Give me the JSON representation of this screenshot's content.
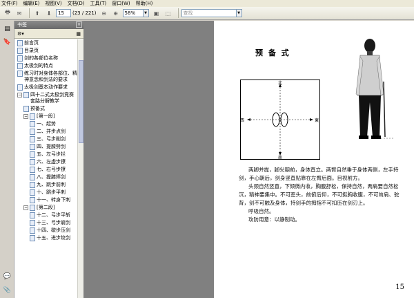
{
  "menu": [
    "文件(F)",
    "编辑(E)",
    "视图(V)",
    "文档(D)",
    "工具(T)",
    "窗口(W)",
    "帮助(H)"
  ],
  "toolbar": {
    "page_current": "15",
    "page_total": "(23 / 221)",
    "zoom": "58%",
    "find_placeholder": "查找"
  },
  "panel": {
    "title": "书签",
    "close": "×"
  },
  "bookmarks": [
    {
      "label": "前言页",
      "level": 0,
      "expander": ""
    },
    {
      "label": "目录页",
      "level": 0,
      "expander": ""
    },
    {
      "label": "剑的各部位名称",
      "level": 0,
      "expander": ""
    },
    {
      "label": "太极剑的特点",
      "level": 0,
      "expander": ""
    },
    {
      "label": "练习时对身体各部位、精神意念和剑法的要求",
      "level": 0,
      "expander": ""
    },
    {
      "label": "太极剑基本动作要求",
      "level": 0,
      "expander": ""
    },
    {
      "label": "四十二式太极剑竞赛套路分解教学",
      "level": 0,
      "expander": "−"
    },
    {
      "label": "预备式",
      "level": 1,
      "expander": ""
    },
    {
      "label": "[第一段]",
      "level": 1,
      "expander": "−"
    },
    {
      "label": "一、起势",
      "level": 2,
      "expander": ""
    },
    {
      "label": "二、并步点剑",
      "level": 2,
      "expander": ""
    },
    {
      "label": "三、弓步削剑",
      "level": 2,
      "expander": ""
    },
    {
      "label": "四、提膝劈剑",
      "level": 2,
      "expander": ""
    },
    {
      "label": "五、左弓步拦",
      "level": 2,
      "expander": ""
    },
    {
      "label": "六、左虚步撩",
      "level": 2,
      "expander": ""
    },
    {
      "label": "七、右弓步撩",
      "level": 2,
      "expander": ""
    },
    {
      "label": "八、提膝捧剑",
      "level": 2,
      "expander": ""
    },
    {
      "label": "九、跳步前刺",
      "level": 2,
      "expander": ""
    },
    {
      "label": "十、跳步平刺",
      "level": 2,
      "expander": ""
    },
    {
      "label": "十一、转身下刺",
      "level": 2,
      "expander": ""
    },
    {
      "label": "[第二段]",
      "level": 1,
      "expander": "−"
    },
    {
      "label": "十二、弓步平斩",
      "level": 2,
      "expander": ""
    },
    {
      "label": "十三、弓步崩剑",
      "level": 2,
      "expander": ""
    },
    {
      "label": "十四、歇步压剑",
      "level": 2,
      "expander": ""
    },
    {
      "label": "十五、进步绞剑",
      "level": 2,
      "expander": ""
    }
  ],
  "document": {
    "title": "预 备 式",
    "diagram": {
      "north": "北",
      "south": "南",
      "west": "西",
      "east": "東"
    },
    "paragraphs": [
      "两脚并拢，脚尖朝前，身体直立。两臂自然垂于身体两侧，左手持剑，手心朝后，剑身竖直贴靠在左臂后面。目视前方。",
      "头颈自然竖直，下颏微内收，胸腹舒松，保持自然，两肩要自然松沉，精神要集中。不可歪头，前俯后仰，不可挺胸收腹，不可耸肩、驼背，剑不可触及身体，持剑手的拇指不可扣压在剑刃上。",
      "呼吸自然。",
      "攻防用意：以静制动。"
    ],
    "page_number": "15"
  }
}
